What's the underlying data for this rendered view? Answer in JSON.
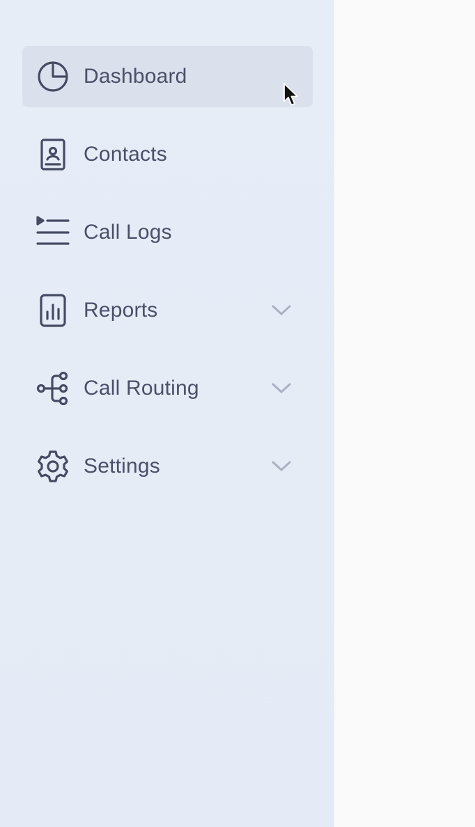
{
  "sidebar": {
    "items": [
      {
        "label": "Dashboard",
        "icon": "pie-chart-icon",
        "active": true,
        "expandable": false
      },
      {
        "label": "Contacts",
        "icon": "contact-book-icon",
        "active": false,
        "expandable": false
      },
      {
        "label": "Call Logs",
        "icon": "list-icon",
        "active": false,
        "expandable": false
      },
      {
        "label": "Reports",
        "icon": "bar-chart-icon",
        "active": false,
        "expandable": true
      },
      {
        "label": "Call Routing",
        "icon": "routing-icon",
        "active": false,
        "expandable": true
      },
      {
        "label": "Settings",
        "icon": "gear-icon",
        "active": false,
        "expandable": true
      }
    ]
  },
  "colors": {
    "sidebar_bg": "#e6ecf6",
    "active_bg": "#dae1ec",
    "text": "#4a5068",
    "icon": "#454b63",
    "chevron": "#a9b2c3",
    "main_bg": "#fafafa"
  }
}
